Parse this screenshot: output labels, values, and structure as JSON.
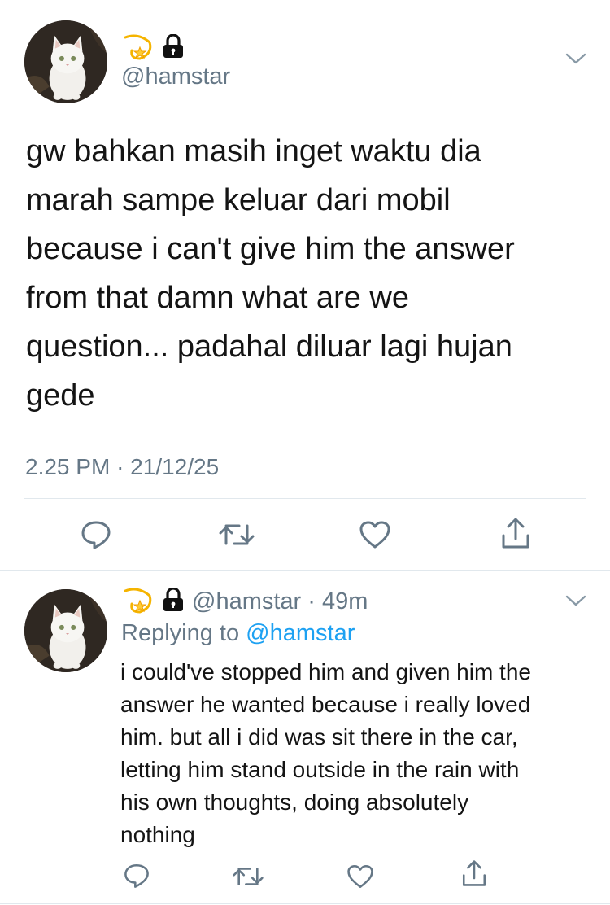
{
  "main_tweet": {
    "display_name_icons": [
      "dizzy-star-emoji-icon",
      "lock-icon"
    ],
    "handle": "@hamstar",
    "text": "gw bahkan masih inget waktu dia\nmarah sampe keluar dari mobil\nbecause i can't give him the answer\nfrom that damn what are we\nquestion... padahal diluar lagi hujan\ngede",
    "time": "2.25 PM",
    "separator": "·",
    "date": "21/12/25",
    "actions": [
      "reply-icon",
      "retweet-icon",
      "like-icon",
      "share-icon"
    ]
  },
  "reply_tweet": {
    "display_name_icons": [
      "dizzy-star-emoji-icon",
      "lock-icon"
    ],
    "handle": "@hamstar",
    "separator": "·",
    "time_ago": "49m",
    "replying_to_label": "Replying to",
    "replying_to_handle": "@hamstar",
    "text": "i could've stopped him and given him the\nanswer he wanted because i really loved\nhim. but all i did was sit there in the car,\nletting him stand outside in the rain with\nhis own thoughts, doing absolutely\nnothing",
    "actions": [
      "reply-icon",
      "retweet-icon",
      "like-icon",
      "share-icon"
    ]
  },
  "colors": {
    "text": "#141414",
    "secondary": "#657786",
    "link": "#1da1f2",
    "divider": "#e1e8ed"
  }
}
